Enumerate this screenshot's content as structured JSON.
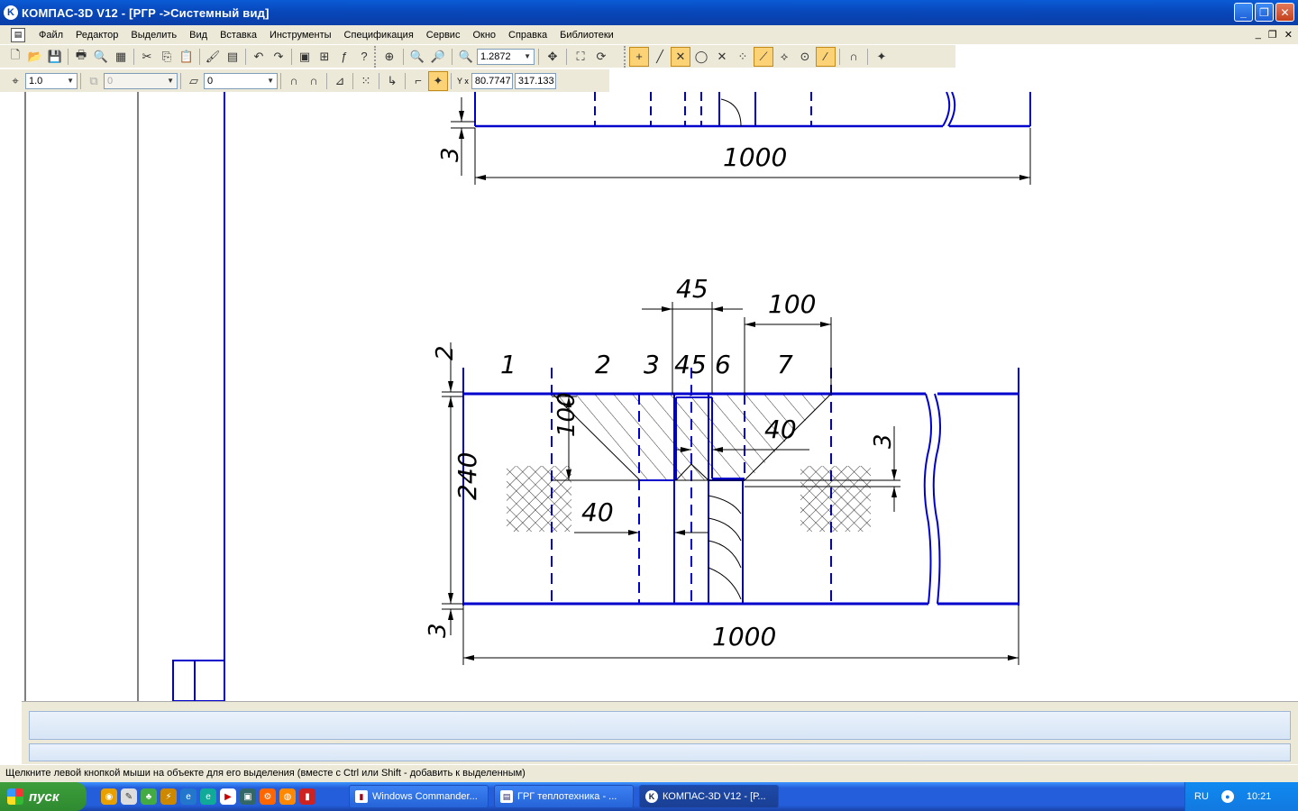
{
  "window": {
    "title": "КОМПАС-3D V12 - [РГР ->Системный вид]",
    "app_icon_letter": "K"
  },
  "menu": [
    "Файл",
    "Редактор",
    "Выделить",
    "Вид",
    "Вставка",
    "Инструменты",
    "Спецификация",
    "Сервис",
    "Окно",
    "Справка",
    "Библиотеки"
  ],
  "toolbar1": {
    "zoom_value": "1.2872"
  },
  "toolbar2": {
    "step_value": "1.0",
    "layer_value": "0",
    "style_value": "0",
    "coord_label": "Y x",
    "coord_x": "80.7747",
    "coord_y": "317.133"
  },
  "drawing": {
    "top_dim_1000": "1000",
    "top_dim_3": "3",
    "dim_45": "45",
    "dim_100_top": "100",
    "zone_labels": [
      "1",
      "2",
      "3",
      "4",
      "5",
      "6",
      "7"
    ],
    "dim_2": "2",
    "dim_240": "240",
    "dim_100_left": "100",
    "dim_40_right": "40",
    "dim_3_right": "3",
    "dim_40_bottom": "40",
    "dim_3_bottom": "3",
    "dim_1000_bottom": "1000",
    "line_color": "#0000cc"
  },
  "status": {
    "hint": "Щелкните левой кнопкой мыши на объекте для его выделения (вместе с Ctrl или Shift - добавить к выделенным)"
  },
  "taskbar": {
    "start_label": "пуск",
    "tasks": [
      "Windows Commander...",
      "ГРГ теплотехника - ...",
      "КОМПАС-3D V12 - [Р..."
    ],
    "lang": "RU",
    "clock": "10:21"
  }
}
